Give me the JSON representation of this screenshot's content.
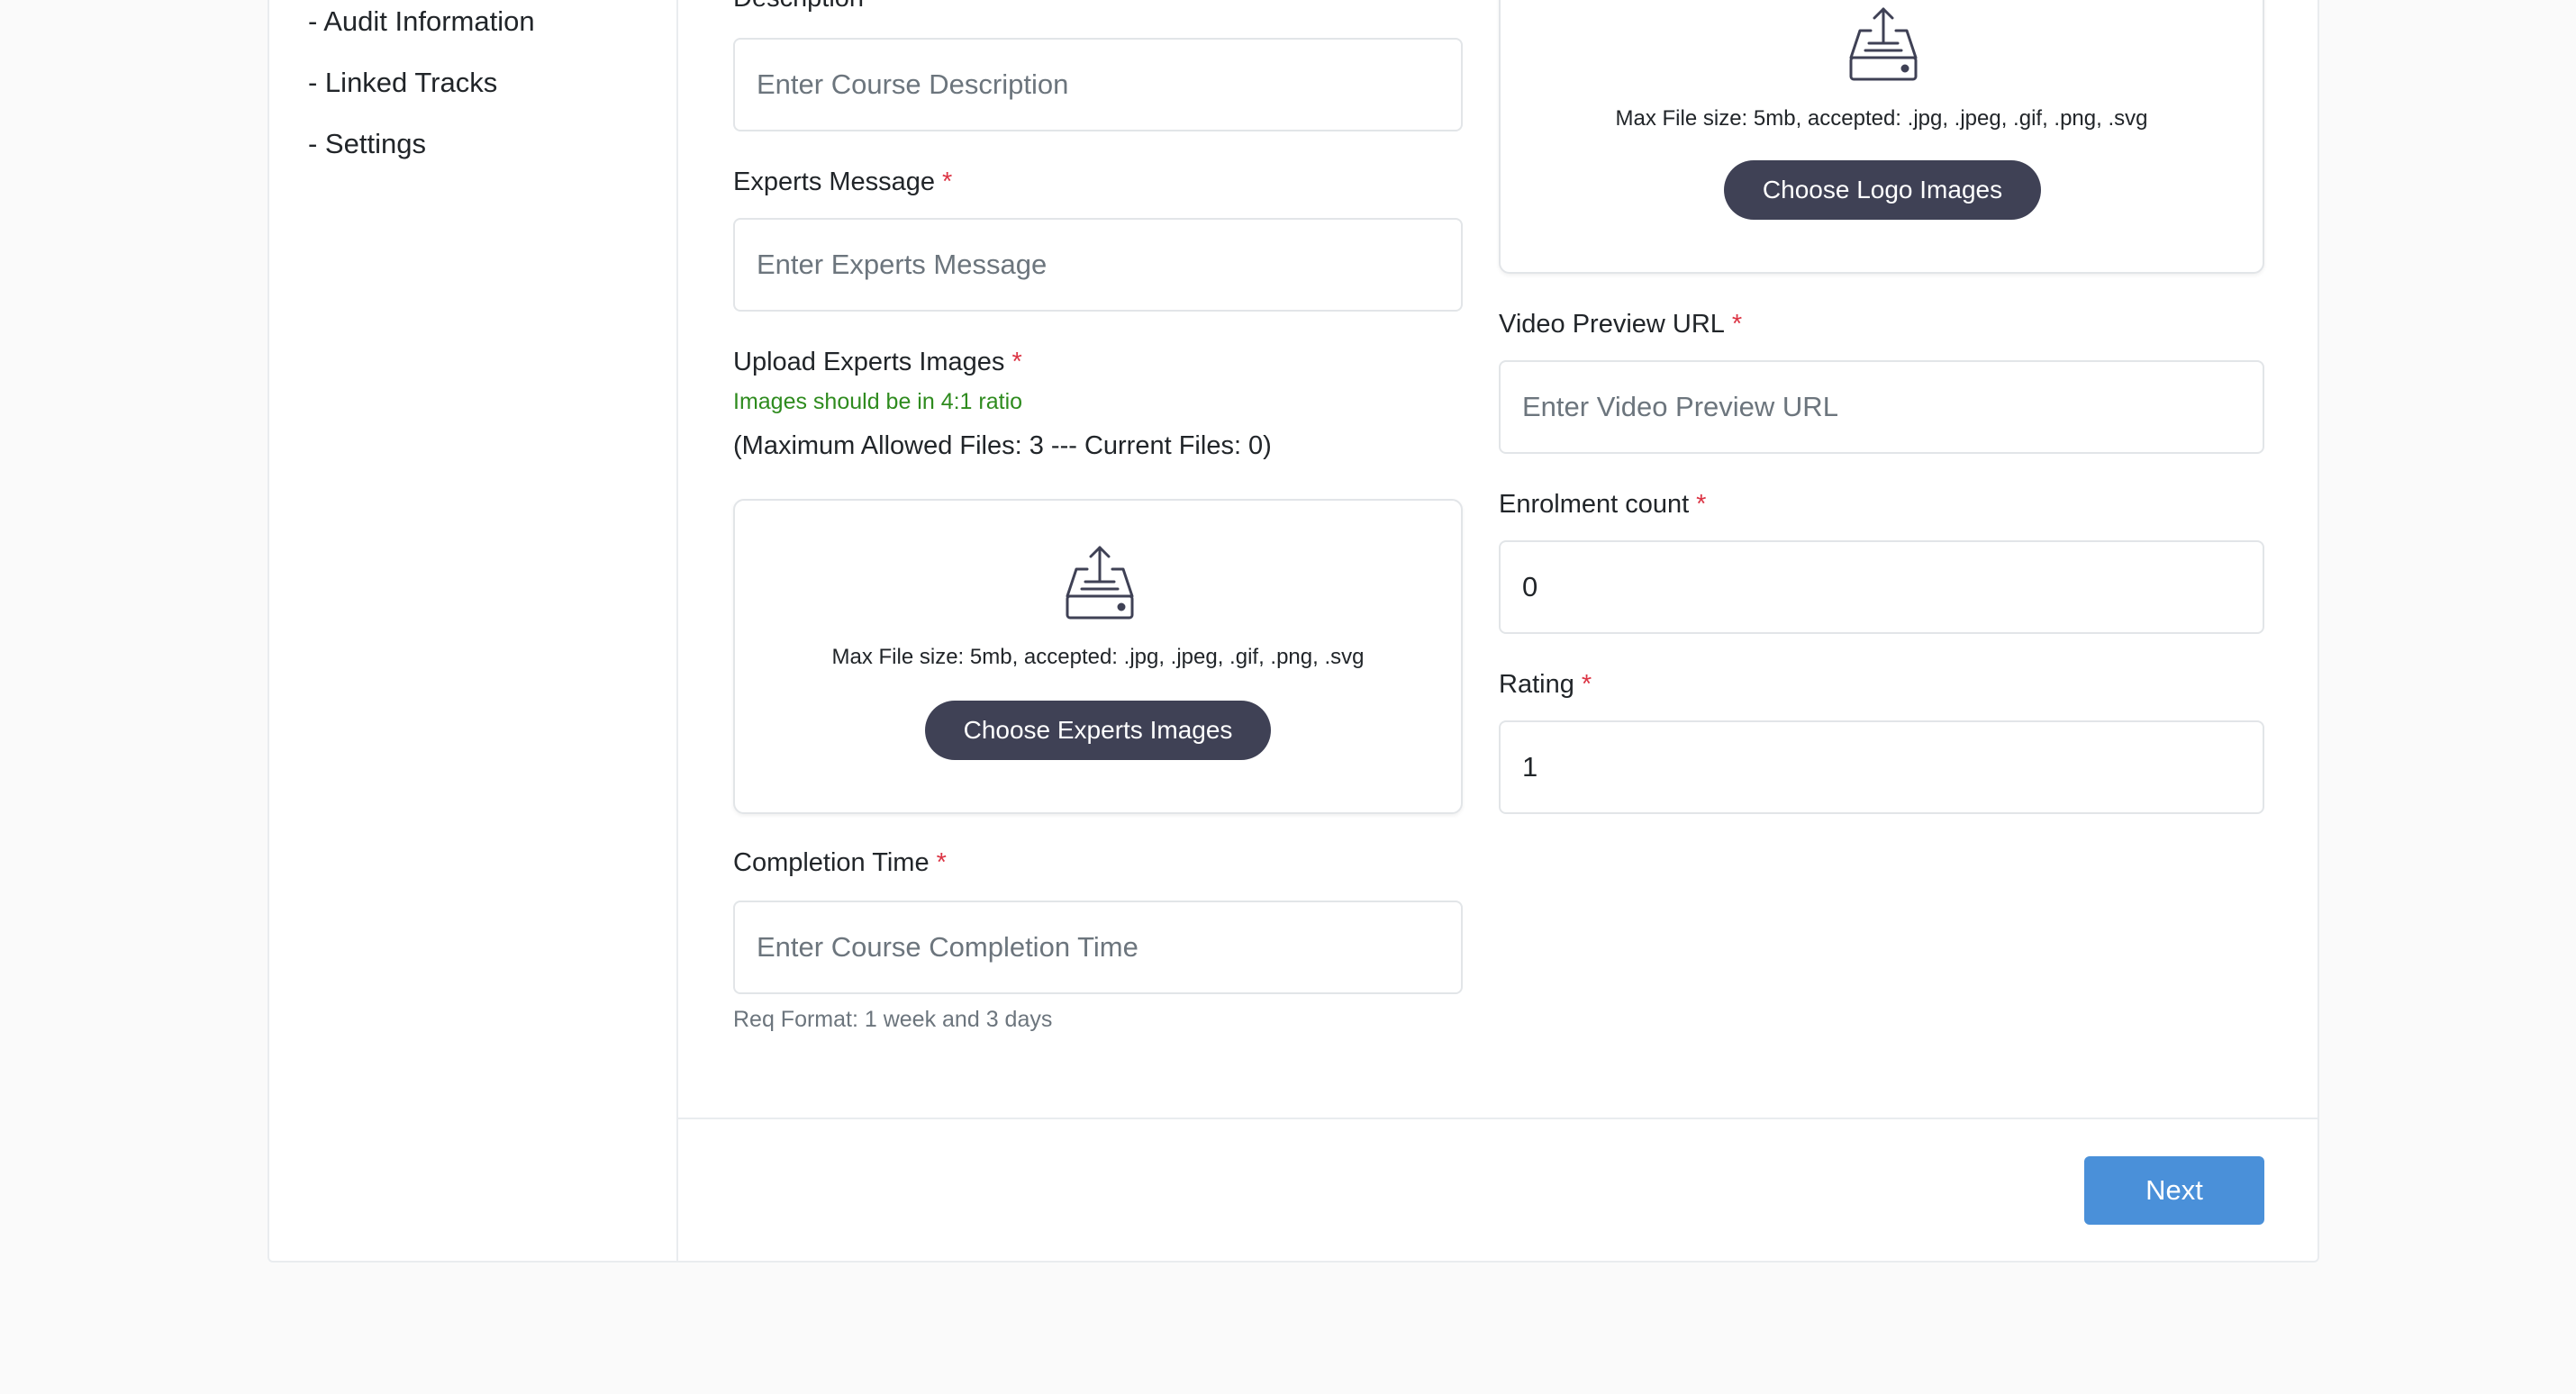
{
  "sidebar": {
    "items": [
      {
        "label": "- Audit Information"
      },
      {
        "label": "- Linked Tracks"
      },
      {
        "label": "- Settings"
      }
    ]
  },
  "left_form": {
    "description": {
      "label": "Description",
      "placeholder": "Enter Course Description"
    },
    "experts_message": {
      "label": "Experts Message",
      "placeholder": "Enter Experts Message"
    },
    "experts_images": {
      "label": "Upload Experts Images",
      "ratio_hint": "Images should be in 4:1 ratio",
      "file_count": "(Maximum Allowed Files: 3 --- Current Files: 0)",
      "note": "Max File size: 5mb, accepted: .jpg, .jpeg, .gif, .png, .svg",
      "button": "Choose Experts Images"
    },
    "completion_time": {
      "label": "Completion Time",
      "placeholder": "Enter Course Completion Time",
      "format_hint": "Req Format: 1 week and 3 days"
    }
  },
  "right_form": {
    "logo_upload": {
      "note": "Max File size: 5mb, accepted: .jpg, .jpeg, .gif, .png, .svg",
      "button": "Choose Logo Images"
    },
    "video_preview": {
      "label": "Video Preview URL",
      "placeholder": "Enter Video Preview URL"
    },
    "enrolment_count": {
      "label": "Enrolment count",
      "value": "0"
    },
    "rating": {
      "label": "Rating",
      "value": "1"
    }
  },
  "required_marker": "*",
  "footer": {
    "next_label": "Next"
  },
  "colors": {
    "required": "#dc3545",
    "hint_green": "#2e8b1e",
    "dark_button": "#3f4155",
    "primary_button": "#4a90d9"
  }
}
